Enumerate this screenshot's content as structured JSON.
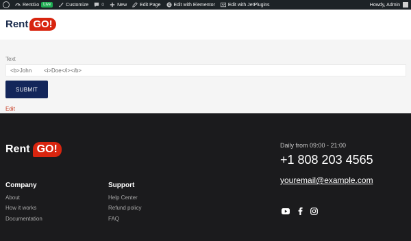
{
  "admin_bar": {
    "site_name": "RentGo",
    "live_badge": "Live",
    "customize": "Customize",
    "comments_count": "0",
    "new": "New",
    "edit_page": "Edit Page",
    "edit_elementor": "Edit with Elementor",
    "edit_jetplugins": "Edit with JetPlugins",
    "greeting": "Howdy, Admin"
  },
  "logo": {
    "rent": "Rent",
    "go": "GO!"
  },
  "form": {
    "label": "Text",
    "value": "<b>John        <i>Doe</i></b>",
    "submit": "SUBMIT",
    "edit": "Edit"
  },
  "footer": {
    "company": {
      "title": "Company",
      "links": [
        "About",
        "How it works",
        "Documentation"
      ]
    },
    "support": {
      "title": "Support",
      "links": [
        "Help Center",
        "Refund policy",
        "FAQ"
      ]
    },
    "hours": "Daily from 09:00 - 21:00",
    "phone": "+1 808 203 4565",
    "email": "youremail@example.com",
    "social": [
      "youtube-icon",
      "facebook-icon",
      "instagram-icon"
    ]
  },
  "colors": {
    "admin_bar": "#1d2327",
    "brand_red": "#d8250f",
    "brand_navy": "#13265a",
    "footer_bg": "#1b1b1d",
    "live_green": "#1eab52"
  }
}
